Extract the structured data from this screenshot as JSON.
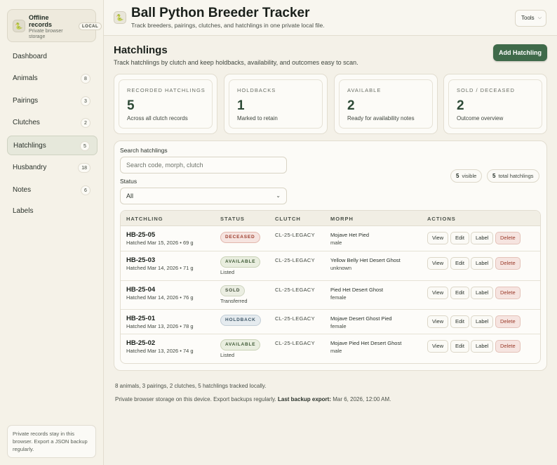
{
  "sidebar": {
    "brand_title": "Offline records",
    "brand_sub": "Private browser storage",
    "brand_badge": "LOCAL",
    "items": [
      {
        "label": "Dashboard",
        "count": null
      },
      {
        "label": "Animals",
        "count": "8"
      },
      {
        "label": "Pairings",
        "count": "3"
      },
      {
        "label": "Clutches",
        "count": "2"
      },
      {
        "label": "Hatchlings",
        "count": "5"
      },
      {
        "label": "Husbandry",
        "count": "18"
      },
      {
        "label": "Notes",
        "count": "6"
      },
      {
        "label": "Labels",
        "count": null
      }
    ],
    "active": "Hatchlings",
    "note": "Private records stay in this browser. Export a JSON backup regularly."
  },
  "header": {
    "title": "Ball Python Breeder Tracker",
    "subtitle": "Track breeders, pairings, clutches, and hatchlings in one private local file.",
    "tools_label": "Tools"
  },
  "main": {
    "title": "Hatchlings",
    "subtitle": "Track hatchlings by clutch and keep holdbacks, availability, and outcomes easy to scan.",
    "add_label": "Add Hatchling",
    "stats": [
      {
        "label": "RECORDED HATCHLINGS",
        "value": "5",
        "desc": "Across all clutch records"
      },
      {
        "label": "HOLDBACKS",
        "value": "1",
        "desc": "Marked to retain"
      },
      {
        "label": "AVAILABLE",
        "value": "2",
        "desc": "Ready for availability notes"
      },
      {
        "label": "SOLD / DECEASED",
        "value": "2",
        "desc": "Outcome overview"
      }
    ],
    "search_label": "Search hatchlings",
    "search_placeholder": "Search code, morph, clutch",
    "status_label": "Status",
    "status_value": "All",
    "visible_count": "5",
    "visible_label": "visible",
    "total_count": "5",
    "total_label": "total hatchlings",
    "columns": [
      "HATCHLING",
      "STATUS",
      "CLUTCH",
      "MORPH",
      "ACTIONS"
    ],
    "rows": [
      {
        "code": "HB-25-05",
        "hatched": "Hatched Mar 15, 2026 • 69 g",
        "status": "DECEASED",
        "status_note": "",
        "clutch": "CL-25-LEGACY",
        "morph": "Mojave Het Pied",
        "sex": "male"
      },
      {
        "code": "HB-25-03",
        "hatched": "Hatched Mar 14, 2026 • 71 g",
        "status": "AVAILABLE",
        "status_note": "Listed",
        "clutch": "CL-25-LEGACY",
        "morph": "Yellow Belly Het Desert Ghost",
        "sex": "unknown"
      },
      {
        "code": "HB-25-04",
        "hatched": "Hatched Mar 14, 2026 • 76 g",
        "status": "SOLD",
        "status_note": "Transferred",
        "clutch": "CL-25-LEGACY",
        "morph": "Pied Het Desert Ghost",
        "sex": "female"
      },
      {
        "code": "HB-25-01",
        "hatched": "Hatched Mar 13, 2026 • 78 g",
        "status": "HOLDBACK",
        "status_note": "",
        "clutch": "CL-25-LEGACY",
        "morph": "Mojave Desert Ghost Pied",
        "sex": "female"
      },
      {
        "code": "HB-25-02",
        "hatched": "Hatched Mar 13, 2026 • 74 g",
        "status": "AVAILABLE",
        "status_note": "Listed",
        "clutch": "CL-25-LEGACY",
        "morph": "Mojave Pied Het Desert Ghost",
        "sex": "male"
      }
    ],
    "actions": [
      "View",
      "Edit",
      "Label",
      "Delete"
    ]
  },
  "footer": {
    "summary": "8 animals, 3 pairings, 2 clutches, 5 hatchlings tracked locally.",
    "storage": "Private browser storage on this device. Export backups regularly.",
    "backup_label": "Last backup export:",
    "backup_value": "Mar 6, 2026, 12:00 AM."
  },
  "colors": {
    "accent": "#3f6a4a",
    "deceased": "#9b3b2b",
    "available": "#3e5a35",
    "holdback": "#3d5666"
  }
}
